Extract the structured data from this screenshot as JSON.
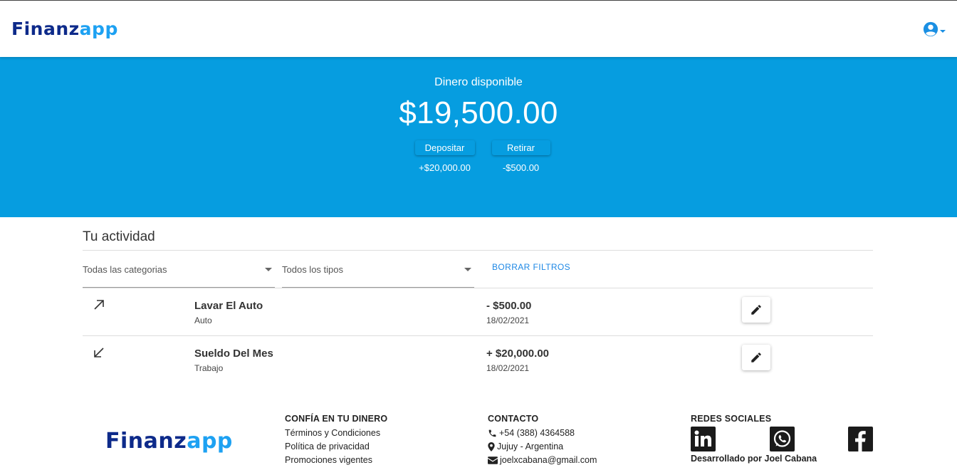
{
  "header": {
    "logo_part1": "Finanz",
    "logo_part2": "app",
    "user_icon": "account-circle-icon"
  },
  "balance": {
    "label": "Dinero disponible",
    "amount": "$19,500.00",
    "deposit_label": "Depositar",
    "deposit_total": "+$20,000.00",
    "withdraw_label": "Retirar",
    "withdraw_total": "-$500.00"
  },
  "activity": {
    "title": "Tu actividad",
    "filters": {
      "category": "Todas las categorias",
      "type": "Todos los tipos",
      "clear_label": "BORRAR FILTROS"
    },
    "items": [
      {
        "direction_icon": "arrow-up-right-icon",
        "name": "Lavar El Auto",
        "category": "Auto",
        "amount": "- $500.00",
        "date": "18/02/2021"
      },
      {
        "direction_icon": "arrow-down-left-icon",
        "name": "Sueldo Del Mes",
        "category": "Trabajo",
        "amount": "+ $20,000.00",
        "date": "18/02/2021"
      }
    ]
  },
  "footer": {
    "logo_part1": "Finanz",
    "logo_part2": "app",
    "trust": {
      "heading": "CONFÍA EN TU DINERO",
      "links": [
        "Términos y Condiciones",
        "Política de privacidad",
        "Promociones vigentes"
      ]
    },
    "contact": {
      "heading": "CONTACTO",
      "phone": "+54 (388) 4364588",
      "location": "Jujuy - Argentina",
      "email": "joelxcabana@gmail.com"
    },
    "social": {
      "heading": "REDES SOCIALES",
      "icons": [
        "linkedin-icon",
        "whatsapp-icon",
        "facebook-icon"
      ],
      "credit": "Desarrollado por Joel Cabana"
    }
  },
  "colors": {
    "brand_dark": "#0d2a8a",
    "brand_light": "#1da1f2",
    "hero_bg": "#069de0",
    "link": "#1e88e5"
  }
}
